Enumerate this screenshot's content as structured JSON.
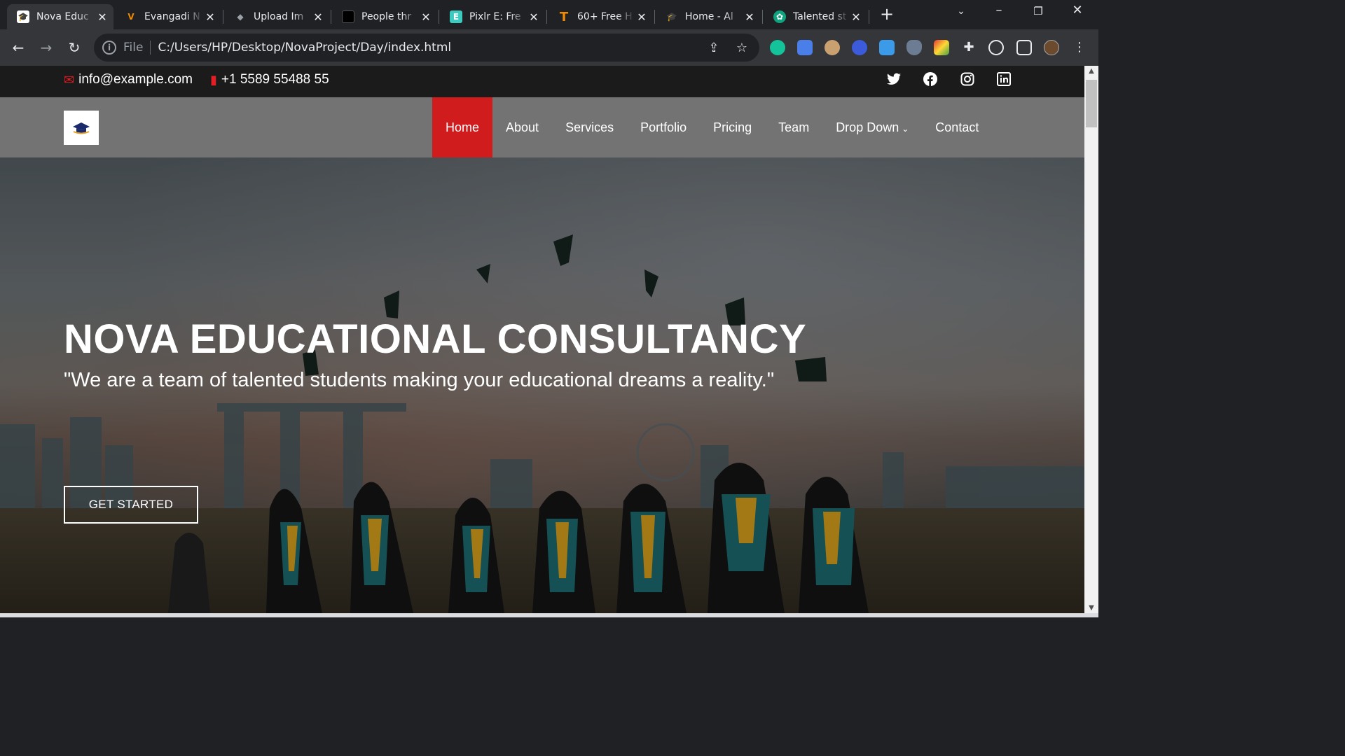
{
  "browser": {
    "tabs": [
      {
        "title": "Nova Educ",
        "favicon": "graduation-cap-icon",
        "color": "#ffffff",
        "active": true
      },
      {
        "title": "Evangadi N",
        "favicon": "evangadi-icon",
        "color": "#f08a00"
      },
      {
        "title": "Upload Im",
        "favicon": "layers-icon",
        "color": "#9aa0a6"
      },
      {
        "title": "People thr",
        "favicon": "unsplash-icon",
        "color": "#000000"
      },
      {
        "title": "Pixlr E: Fre",
        "favicon": "pixlr-icon",
        "color": "#3ecbbf"
      },
      {
        "title": "60+ Free H",
        "favicon": "t-letter-icon",
        "color": "#f08a00"
      },
      {
        "title": "Home - Al",
        "favicon": "graduation-cap-icon",
        "color": "#c9a227"
      },
      {
        "title": "Talented st",
        "favicon": "chatgpt-icon",
        "color": "#10a37f"
      }
    ],
    "address": {
      "scheme_label": "File",
      "url": "C:/Users/HP/Desktop/NovaProject/Day/index.html"
    }
  },
  "site": {
    "topbar": {
      "email": "info@example.com",
      "phone": "+1 5589 55488 55",
      "social": [
        "twitter-icon",
        "facebook-icon",
        "instagram-icon",
        "linkedin-icon"
      ]
    },
    "nav": {
      "items": [
        "Home",
        "About",
        "Services",
        "Portfolio",
        "Pricing",
        "Team",
        "Drop Down",
        "Contact"
      ],
      "active": "Home"
    },
    "hero": {
      "title": "NOVA EDUCATIONAL CONSULTANCY",
      "subtitle": "\"We are a team of talented students making your educational dreams a reality.\"",
      "cta": "GET STARTED"
    },
    "colors": {
      "accent": "#d01c1c",
      "topbar": "#1b1b1b",
      "header": "#787878"
    }
  }
}
